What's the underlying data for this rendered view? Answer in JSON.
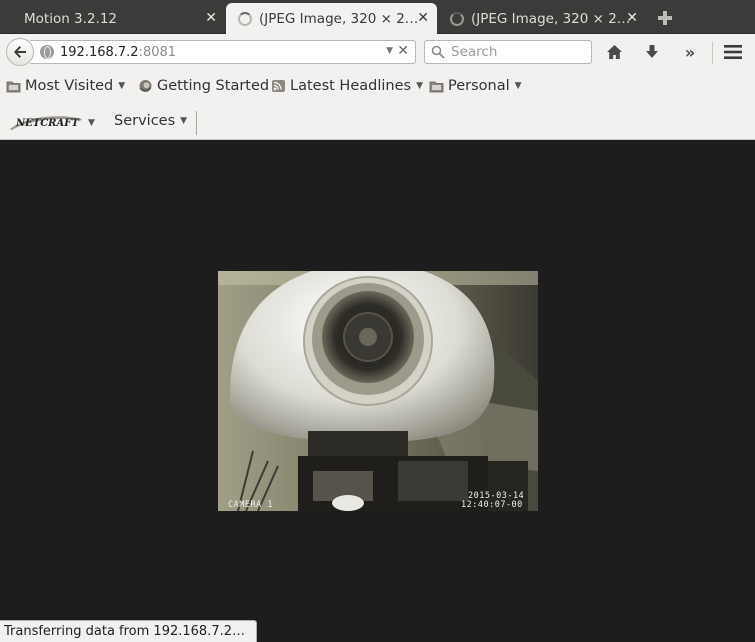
{
  "tabs": [
    {
      "title": "Motion 3.2.12",
      "loading": false,
      "active": false
    },
    {
      "title": "(JPEG Image, 320 × 2…",
      "loading": true,
      "active": true
    },
    {
      "title": "(JPEG Image, 320 × 2…",
      "loading": true,
      "active": false
    }
  ],
  "toolbar": {
    "url_host": "192.168.7.2",
    "url_port": ":8081",
    "search_placeholder": "Search"
  },
  "bookmarks": [
    {
      "label": "Most Visited",
      "icon": "folder-icon",
      "has_menu": true
    },
    {
      "label": "Getting Started",
      "icon": "firefox-icon",
      "has_menu": false
    },
    {
      "label": "Latest Headlines",
      "icon": "rss-feed-icon",
      "has_menu": true
    },
    {
      "label": "Personal",
      "icon": "folder-icon",
      "has_menu": true
    }
  ],
  "netcraft": {
    "logo": "NETCRAFT",
    "services_label": "Services"
  },
  "camera": {
    "label": "CAMERA 1",
    "date": "2015-03-14",
    "time": "12:40:07-00"
  },
  "status": {
    "text": "Transferring data from 192.168.7.2…"
  },
  "colors": {
    "tabstrip": "#3b3b39",
    "toolbar": "#f2f1ef",
    "content_bg": "#1d1d1d"
  }
}
